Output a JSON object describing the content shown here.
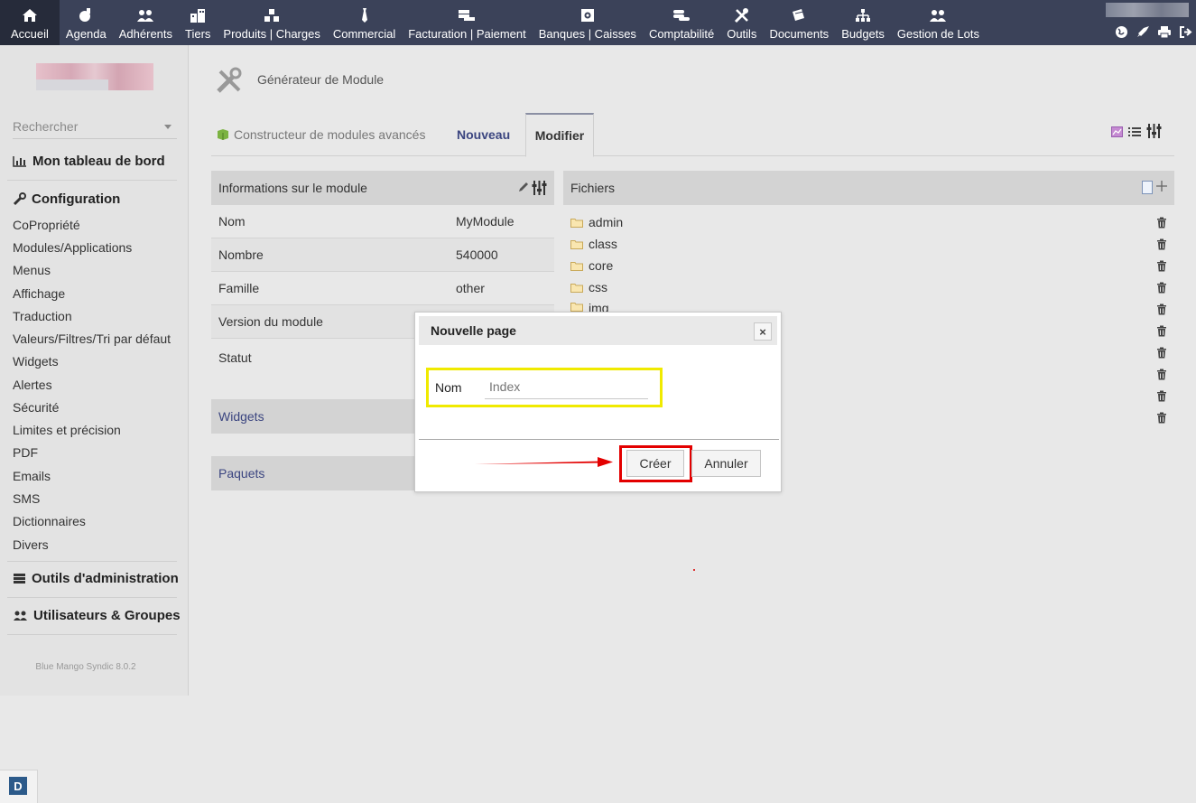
{
  "topmenu": [
    {
      "label": "Accueil",
      "icon": "home-icon"
    },
    {
      "label": "Agenda",
      "icon": "agenda-icon"
    },
    {
      "label": "Adhérents",
      "icon": "users-icon"
    },
    {
      "label": "Tiers",
      "icon": "building-icon"
    },
    {
      "label": "Produits | Charges",
      "icon": "cubes-icon"
    },
    {
      "label": "Commercial",
      "icon": "tie-icon"
    },
    {
      "label": "Facturation | Paiement",
      "icon": "money-icon"
    },
    {
      "label": "Banques | Caisses",
      "icon": "safe-icon"
    },
    {
      "label": "Comptabilité",
      "icon": "coins-icon"
    },
    {
      "label": "Outils",
      "icon": "tools-icon"
    },
    {
      "label": "Documents",
      "icon": "files-icon"
    },
    {
      "label": "Budgets",
      "icon": "sitemap-icon"
    },
    {
      "label": "Gestion de Lots",
      "icon": "group-icon"
    }
  ],
  "sidebar": {
    "search_placeholder": "Rechercher",
    "dashboard": "Mon tableau de bord",
    "configuration": "Configuration",
    "config_items": [
      "CoPropriété",
      "Modules/Applications",
      "Menus",
      "Affichage",
      "Traduction",
      "Valeurs/Filtres/Tri par défaut",
      "Widgets",
      "Alertes",
      "Sécurité",
      "Limites et précision",
      "PDF",
      "Emails",
      "SMS",
      "Dictionnaires",
      "Divers"
    ],
    "admin_tools": "Outils d'administration",
    "users_groups": "Utilisateurs & Groupes",
    "version": "Blue Mango Syndic 8.0.2"
  },
  "page": {
    "title": "Générateur de Module",
    "tabs": [
      "Constructeur de modules avancés",
      "Nouveau",
      "Modifier"
    ]
  },
  "info": {
    "heading": "Informations sur le module",
    "rows": [
      {
        "key": "Nom",
        "value": "MyModule"
      },
      {
        "key": "Nombre",
        "value": "540000"
      },
      {
        "key": "Famille",
        "value": "other"
      },
      {
        "key": "Version du module",
        "value": ""
      },
      {
        "key": "Statut",
        "value": ""
      }
    ],
    "widgets": "Widgets",
    "paquets": "Paquets"
  },
  "files": {
    "heading": "Fichiers",
    "folders": [
      "admin",
      "class",
      "core",
      "css",
      "img"
    ]
  },
  "dialog": {
    "title": "Nouvelle page",
    "close": "×",
    "field_label": "Nom",
    "field_placeholder": "Index",
    "create": "Créer",
    "cancel": "Annuler"
  },
  "colors": {
    "topbar": "#3b4259",
    "highlight_yellow": "#f0ea00",
    "highlight_red": "#e30000"
  }
}
